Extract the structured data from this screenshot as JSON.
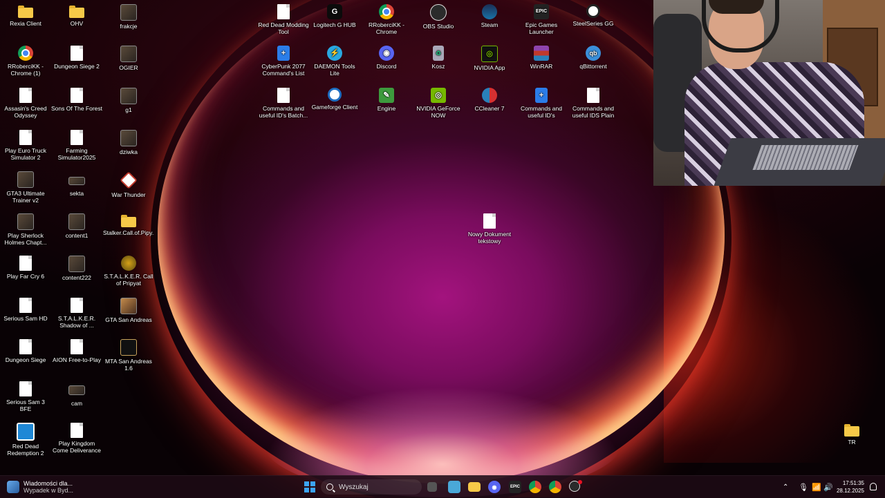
{
  "desktop": {
    "icons_col1": [
      {
        "label": "Rexia Client",
        "kind": "folder"
      },
      {
        "label": "RRoberciKK - Chrome (1)",
        "kind": "chrome"
      },
      {
        "label": "Assasin's Creed Odyssey",
        "kind": "doc"
      },
      {
        "label": "Play Euro Truck Simulator 2",
        "kind": "doc"
      },
      {
        "label": "GTA3 Ultimate Trainer v2",
        "kind": "photo"
      },
      {
        "label": "Play Sherlock Holmes Chapt...",
        "kind": "photo"
      },
      {
        "label": "Play Far Cry 6",
        "kind": "doc"
      },
      {
        "label": "Serious Sam HD",
        "kind": "doc"
      },
      {
        "label": "Dungeon Siege",
        "kind": "doc"
      },
      {
        "label": "Serious Sam 3 BFE",
        "kind": "doc"
      },
      {
        "label": "Red Dead Redemption 2",
        "kind": "app"
      }
    ],
    "icons_col2": [
      {
        "label": "OHV",
        "kind": "folder"
      },
      {
        "label": "Dungeon Siege 2",
        "kind": "doc"
      },
      {
        "label": "Sons Of The Forest",
        "kind": "doc"
      },
      {
        "label": "Farming Simulator2025",
        "kind": "doc"
      },
      {
        "label": "sekta",
        "kind": "photo"
      },
      {
        "label": "content1",
        "kind": "photo"
      },
      {
        "label": "content222",
        "kind": "photo"
      },
      {
        "label": "S.T.A.L.K.E.R. Shadow of ...",
        "kind": "doc"
      },
      {
        "label": "AION Free-to-Play",
        "kind": "doc"
      },
      {
        "label": "cam",
        "kind": "photo"
      },
      {
        "label": "Play Kingdom Come Deliverance II",
        "kind": "doc"
      }
    ],
    "icons_col3": [
      {
        "label": "frakcje",
        "kind": "photo"
      },
      {
        "label": "OGIER",
        "kind": "photo"
      },
      {
        "label": "g1",
        "kind": "photo"
      },
      {
        "label": "dziwka",
        "kind": "photo"
      },
      {
        "label": "War Thunder",
        "kind": "app"
      },
      {
        "label": "Stalker.Call.of.Pipy...",
        "kind": "folder"
      },
      {
        "label": "S.T.A.L.K.E.R. Call of Pripyat",
        "kind": "app"
      },
      {
        "label": "GTA San Andreas",
        "kind": "photo"
      },
      {
        "label": "MTA San Andreas 1.6",
        "kind": "photo"
      }
    ],
    "icons_row1": [
      {
        "label": "Red Dead Modding Tool",
        "kind": "doc"
      },
      {
        "label": "Logitech G HUB",
        "kind": "app"
      },
      {
        "label": "RRoberciKK - Chrome",
        "kind": "chrome"
      },
      {
        "label": "OBS Studio",
        "kind": "app"
      },
      {
        "label": "Steam",
        "kind": "app"
      },
      {
        "label": "Epic Games Launcher",
        "kind": "app"
      },
      {
        "label": "SteelSeries GG",
        "kind": "app"
      }
    ],
    "icons_row2": [
      {
        "label": "CyberPunk 2077 Command's List",
        "kind": "doc"
      },
      {
        "label": "DAEMON Tools Lite",
        "kind": "app"
      },
      {
        "label": "Discord",
        "kind": "app"
      },
      {
        "label": "Kosz",
        "kind": "app"
      },
      {
        "label": "NVIDIA App",
        "kind": "app"
      },
      {
        "label": "WinRAR",
        "kind": "app"
      },
      {
        "label": "qBittorrent",
        "kind": "app"
      }
    ],
    "icons_row3": [
      {
        "label": "Commands and useful ID's Batch...",
        "kind": "doc"
      },
      {
        "label": "Gameforge Client",
        "kind": "app"
      },
      {
        "label": "Engine",
        "kind": "app"
      },
      {
        "label": "NVIDIA GeForce NOW",
        "kind": "app"
      },
      {
        "label": "CCleaner 7",
        "kind": "app"
      },
      {
        "label": "Commands and useful ID's",
        "kind": "doc"
      },
      {
        "label": "Commands and useful IDS Plain Text",
        "kind": "doc"
      }
    ],
    "new_doc": {
      "label": "Nowy Dokument tekstowy",
      "kind": "doc"
    },
    "tr_folder": {
      "label": "TR",
      "kind": "folder"
    }
  },
  "taskbar": {
    "news_title": "Wiadomości dla...",
    "news_subtitle": "Wypadek w Byd...",
    "search_placeholder": "Wyszukaj",
    "time": "17:51:35",
    "date": "28.12.2025",
    "apps": [
      "file-explorer",
      "photos",
      "folder",
      "discord",
      "epic-games",
      "chrome",
      "chrome-profile",
      "obs-studio"
    ]
  },
  "colors": {
    "accent": "#3ca3f4",
    "taskbar_bg": "#1c0a14"
  }
}
